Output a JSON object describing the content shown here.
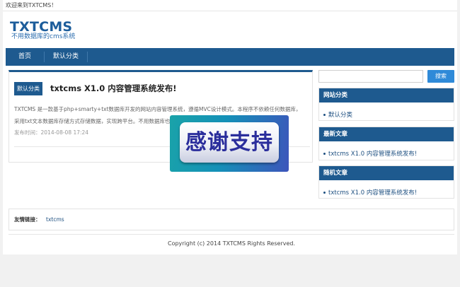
{
  "topbar": {
    "welcome": "欢迎来到TXTCMS！"
  },
  "header": {
    "logo": "TXTCMS",
    "tagline": "不用数据库的cms系统"
  },
  "nav": {
    "items": [
      {
        "label": "首页"
      },
      {
        "label": "默认分类"
      }
    ]
  },
  "post": {
    "category": "默认分类",
    "title": "txtcms X1.0 内容管理系统发布!",
    "excerpt_line1": "TXTCMS 是一款基于php+smarty+txt数据库开发的网站内容管理系统，遵循MVC设计模式。本程序不依赖任何数据库，",
    "excerpt_line2": "采用txt文本数据库存储方式存储数据，实现跨平台。不用数据库也",
    "date": "发布时间：2014-08-08 17:24"
  },
  "overlay": {
    "text": "感谢支持"
  },
  "search": {
    "button_label": "搜索",
    "value": ""
  },
  "sidebar": {
    "categories": {
      "title": "网站分类",
      "items": [
        "默认分类"
      ]
    },
    "latest": {
      "title": "最新文章",
      "items": [
        "txtcms X1.0 内容管理系统发布!"
      ]
    },
    "random": {
      "title": "随机文章",
      "items": [
        "txtcms X1.0 内容管理系统发布!"
      ]
    }
  },
  "links": {
    "label": "友情链接：",
    "items": [
      "txtcms"
    ]
  },
  "footer": {
    "copyright": "Copyright (c) 2014 TXTCMS Rights Reserved."
  },
  "colors": {
    "primary": "#1e5a8f",
    "search_button": "#2f8ad8",
    "logo": "#1d5d9b"
  }
}
